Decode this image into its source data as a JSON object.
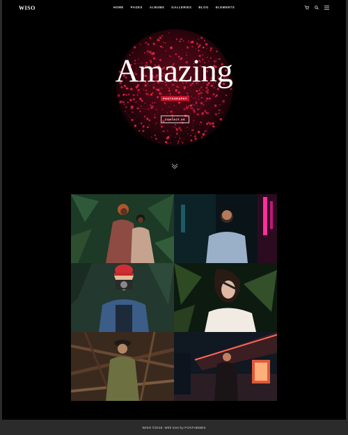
{
  "header": {
    "logo": "WISO",
    "nav": [
      "HOME",
      "PAGES",
      "ALBUMS",
      "GALLERIES",
      "BLOG",
      "ELEMENTS"
    ],
    "icons": [
      "cart-icon",
      "search-icon",
      "menu-icon"
    ]
  },
  "hero": {
    "title": "Amazing",
    "tag": "PHOTOGRAPHY",
    "button": "CONTACT US"
  },
  "gallery": {
    "photos": [
      "couple-jungle-photo",
      "neon-portrait-photo",
      "camera-girl-photo",
      "palm-woman-photo",
      "branches-woman-photo",
      "neon-street-photo"
    ]
  },
  "footer": {
    "text": "WISO ©2018. With love by FOXTHEMES"
  },
  "colors": {
    "accent": "#c8142d",
    "background": "#000000",
    "footer": "#2b2b2b"
  }
}
